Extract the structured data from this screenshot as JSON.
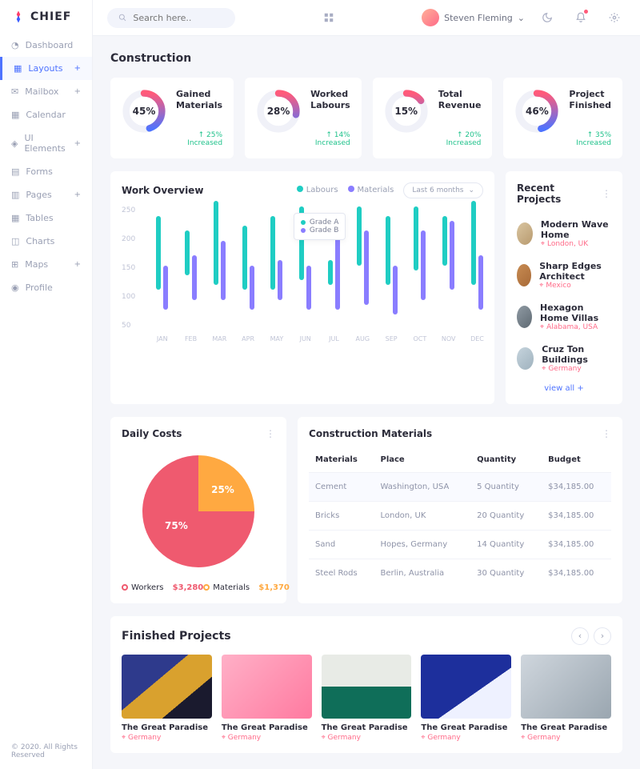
{
  "brand": "CHIEF",
  "search_placeholder": "Search here..",
  "user_name": "Steven Fleming",
  "footer": "© 2020. All Rights Reserved",
  "nav": [
    {
      "label": "Dashboard",
      "exp": false
    },
    {
      "label": "Layouts",
      "exp": true,
      "active": true
    },
    {
      "label": "Mailbox",
      "exp": true
    },
    {
      "label": "Calendar",
      "exp": false
    },
    {
      "label": "UI Elements",
      "exp": true
    },
    {
      "label": "Forms",
      "exp": false
    },
    {
      "label": "Pages",
      "exp": true
    },
    {
      "label": "Tables",
      "exp": false
    },
    {
      "label": "Charts",
      "exp": false
    },
    {
      "label": "Maps",
      "exp": true
    },
    {
      "label": "Profile",
      "exp": false
    }
  ],
  "page_title": "Construction",
  "kpis": [
    {
      "pct": "45%",
      "title": "Gained Materials",
      "delta": "↑ 25% Increased",
      "ringFrom": "#4e73ff",
      "ringTo": "#ff5a7a",
      "deg": 162
    },
    {
      "pct": "28%",
      "title": "Worked Labours",
      "delta": "↑ 14% Increased",
      "ringFrom": "#4e73ff",
      "ringTo": "#ff5a7a",
      "deg": 101
    },
    {
      "pct": "15%",
      "title": "Total Revenue",
      "delta": "↑ 20% Increased",
      "ringFrom": "#4e73ff",
      "ringTo": "#ff5a7a",
      "deg": 54
    },
    {
      "pct": "46%",
      "title": "Project Finished",
      "delta": "↑ 35% Increased",
      "ringFrom": "#4e73ff",
      "ringTo": "#ff5a7a",
      "deg": 166
    }
  ],
  "overview": {
    "title": "Work Overview",
    "legend": [
      {
        "label": "Labours",
        "color": "#1fcdc3"
      },
      {
        "label": "Materials",
        "color": "#8a7dff"
      }
    ],
    "period": "Last 6 months",
    "tooltip": {
      "a": "Grade A",
      "b": "Grade B"
    }
  },
  "chart_data": {
    "type": "bar",
    "xlabel": "",
    "ylabel": "",
    "ylim": [
      0,
      250
    ],
    "yticks": [
      50,
      100,
      150,
      200,
      250
    ],
    "categories": [
      "JAN",
      "FEB",
      "MAR",
      "APR",
      "MAY",
      "JUN",
      "JUL",
      "AUG",
      "SEP",
      "OCT",
      "NOV",
      "DEC"
    ],
    "series": [
      {
        "name": "Labours",
        "color": "#1fcdc3",
        "values": [
          [
            80,
            230
          ],
          [
            110,
            200
          ],
          [
            90,
            260
          ],
          [
            80,
            210
          ],
          [
            80,
            230
          ],
          [
            100,
            250
          ],
          [
            90,
            140
          ],
          [
            130,
            250
          ],
          [
            90,
            230
          ],
          [
            120,
            250
          ],
          [
            130,
            230
          ],
          [
            90,
            260
          ]
        ]
      },
      {
        "name": "Materials",
        "color": "#8a7dff",
        "values": [
          [
            40,
            130
          ],
          [
            60,
            150
          ],
          [
            60,
            180
          ],
          [
            40,
            130
          ],
          [
            60,
            140
          ],
          [
            40,
            130
          ],
          [
            40,
            220
          ],
          [
            50,
            200
          ],
          [
            30,
            130
          ],
          [
            60,
            200
          ],
          [
            80,
            220
          ],
          [
            40,
            150
          ]
        ]
      }
    ]
  },
  "recent": {
    "title": "Recent Projects",
    "items": [
      {
        "name": "Modern Wave Home",
        "loc": "London, UK",
        "bg": "linear-gradient(135deg,#d9c5a0,#b89a6f)"
      },
      {
        "name": "Sharp Edges Architect",
        "loc": "Mexico",
        "bg": "linear-gradient(135deg,#c78b52,#a86a38)"
      },
      {
        "name": "Hexagon Home Villas",
        "loc": "Alabama, USA",
        "bg": "linear-gradient(135deg,#8f9aa3,#5f6a73)"
      },
      {
        "name": "Cruz Ton Buildings",
        "loc": "Germany",
        "bg": "linear-gradient(135deg,#c6d4dd,#9fb2be)"
      }
    ],
    "view_all": "view all +"
  },
  "daily": {
    "title": "Daily Costs",
    "slices": [
      {
        "label": "25%",
        "pct": 25
      },
      {
        "label": "75%",
        "pct": 75
      }
    ],
    "legend": [
      {
        "label": "Workers",
        "value": "$3,280",
        "color": "#ef5a6f"
      },
      {
        "label": "Materials",
        "value": "$1,370",
        "color": "#ffa941"
      }
    ]
  },
  "materials": {
    "title": "Construction Materials",
    "cols": [
      "Materials",
      "Place",
      "Quantity",
      "Budget"
    ],
    "rows": [
      {
        "m": "Cement",
        "p": "Washington, USA",
        "q": "5 Quantity",
        "b": "$34,185.00",
        "hl": true
      },
      {
        "m": "Bricks",
        "p": "London, UK",
        "q": "20 Quantity",
        "b": "$34,185.00"
      },
      {
        "m": "Sand",
        "p": "Hopes, Germany",
        "q": "14 Quantity",
        "b": "$34,185.00"
      },
      {
        "m": "Steel Rods",
        "p": "Berlin, Australia",
        "q": "30 Quantity",
        "b": "$34,185.00"
      }
    ]
  },
  "finished": {
    "title": "Finished Projects",
    "items": [
      {
        "name": "The Great Paradise",
        "loc": "Germany",
        "bg": "linear-gradient(140deg,#2e3a8c 0 40%,#d9a12e 40% 70%,#1a1a2e 70%)"
      },
      {
        "name": "The Great Paradise",
        "loc": "Germany",
        "bg": "linear-gradient(135deg,#ffb0c7,#ff7aa0)"
      },
      {
        "name": "The Great Paradise",
        "loc": "Germany",
        "bg": "linear-gradient(180deg,#e8ebe6 0 50%,#0f6e59 50%)"
      },
      {
        "name": "The Great Paradise",
        "loc": "Germany",
        "bg": "linear-gradient(145deg,#1d2f9c 0 60%,#eef1ff 60%)"
      },
      {
        "name": "The Great Paradise",
        "loc": "Germany",
        "bg": "linear-gradient(135deg,#cfd6dd,#9aa6b0)"
      }
    ]
  }
}
